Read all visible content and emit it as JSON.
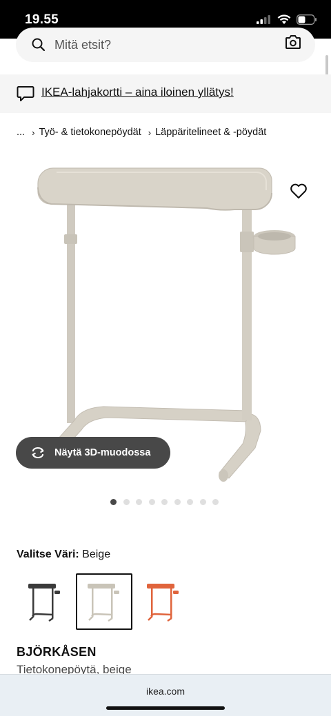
{
  "status_bar": {
    "time": "19.55"
  },
  "search": {
    "placeholder": "Mitä etsit?"
  },
  "banner": {
    "text": "IKEA-lahjakortti – aina iloinen yllätys!"
  },
  "breadcrumb": {
    "items": [
      "...",
      "Työ- & tietokonepöydät",
      "Läppäritelineet & -pöydät"
    ]
  },
  "product": {
    "view_3d_label": "Näytä 3D-muodossa",
    "image_count": 9,
    "active_image": 1,
    "color_label": "Valitse Väri:",
    "color_value": "Beige",
    "name": "BJÖRKÅSEN",
    "description": "Tietokonepöytä, beige"
  },
  "color_swatches": [
    {
      "name": "dark-grey",
      "color": "#3a3a3a",
      "selected": false
    },
    {
      "name": "beige",
      "color": "#c9c4b8",
      "selected": true
    },
    {
      "name": "orange",
      "color": "#e0643c",
      "selected": false
    }
  ],
  "browser": {
    "url": "ikea.com"
  }
}
